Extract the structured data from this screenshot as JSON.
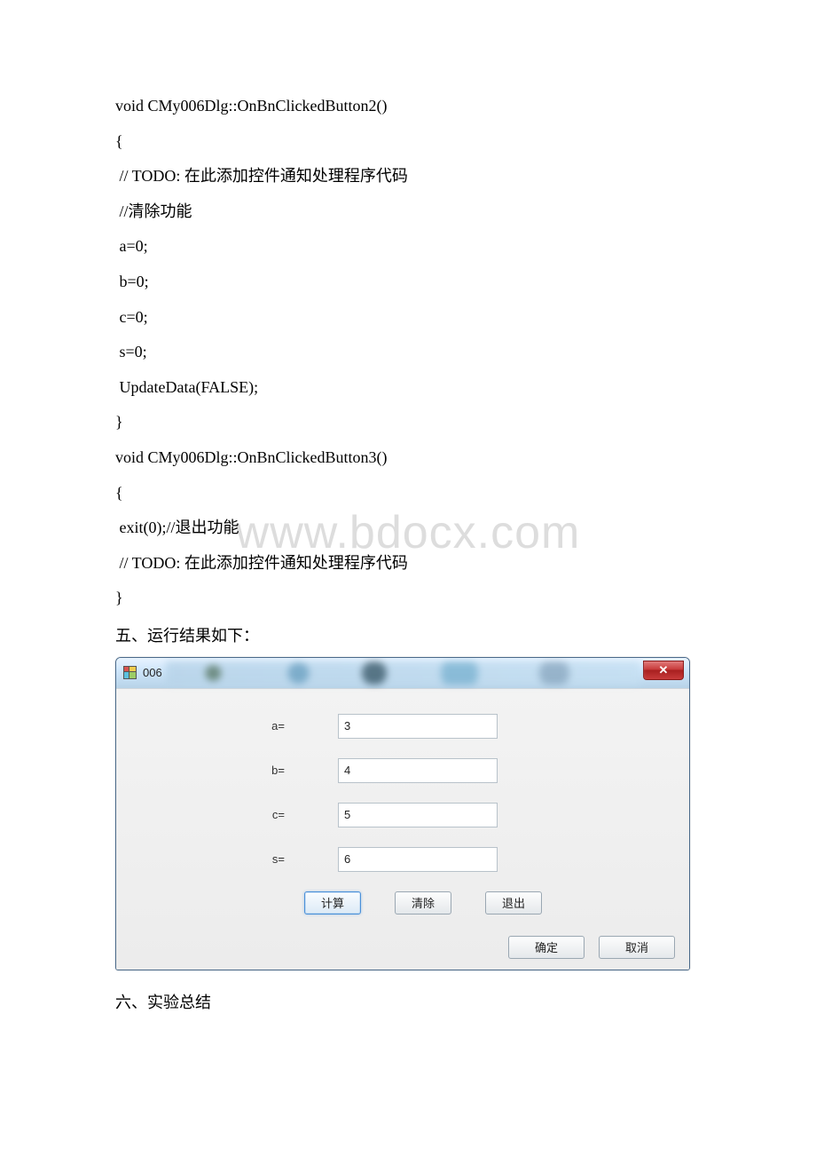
{
  "watermark": "www.bdocx.com",
  "code_lines": [
    "void CMy006Dlg::OnBnClickedButton2()",
    "{",
    " // TODO: 在此添加控件通知处理程序代码",
    " //清除功能",
    " a=0;",
    " b=0;",
    " c=0;",
    " s=0;",
    " UpdateData(FALSE);",
    "}",
    "void CMy006Dlg::OnBnClickedButton3()",
    "{",
    " exit(0);//退出功能",
    " // TODO: 在此添加控件通知处理程序代码",
    "}"
  ],
  "heading_results": "五、运行结果如下：",
  "heading_summary": "六、实验总结",
  "dialog": {
    "title": "006",
    "close_symbol": "✕",
    "fields": {
      "a": {
        "label": "a=",
        "value": "3"
      },
      "b": {
        "label": "b=",
        "value": "4"
      },
      "c": {
        "label": "c=",
        "value": "5"
      },
      "s": {
        "label": "s=",
        "value": "6"
      }
    },
    "buttons": {
      "calc": "计算",
      "clear": "清除",
      "exit": "退出",
      "ok": "确定",
      "cancel": "取消"
    }
  }
}
